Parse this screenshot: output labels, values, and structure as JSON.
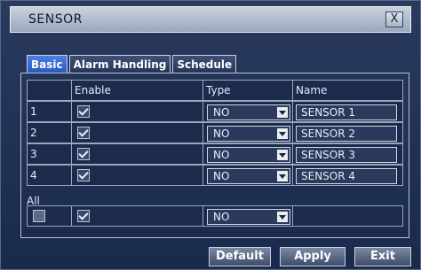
{
  "window": {
    "title": "SENSOR",
    "close_label": "X"
  },
  "tabs": [
    {
      "label": "Basic",
      "active": true
    },
    {
      "label": "Alarm Handling",
      "active": false
    },
    {
      "label": "Schedule",
      "active": false
    }
  ],
  "table": {
    "headers": [
      "",
      "Enable",
      "Type",
      "Name"
    ],
    "rows": [
      {
        "index": "1",
        "enabled": true,
        "type": "NO",
        "name": "SENSOR  1"
      },
      {
        "index": "2",
        "enabled": true,
        "type": "NO",
        "name": "SENSOR  2"
      },
      {
        "index": "3",
        "enabled": true,
        "type": "NO",
        "name": "SENSOR  3"
      },
      {
        "index": "4",
        "enabled": true,
        "type": "NO",
        "name": "SENSOR  4"
      }
    ]
  },
  "all": {
    "label": "All",
    "select_all": false,
    "enabled": true,
    "type": "NO"
  },
  "buttons": {
    "default": "Default",
    "apply": "Apply",
    "exit": "Exit"
  }
}
